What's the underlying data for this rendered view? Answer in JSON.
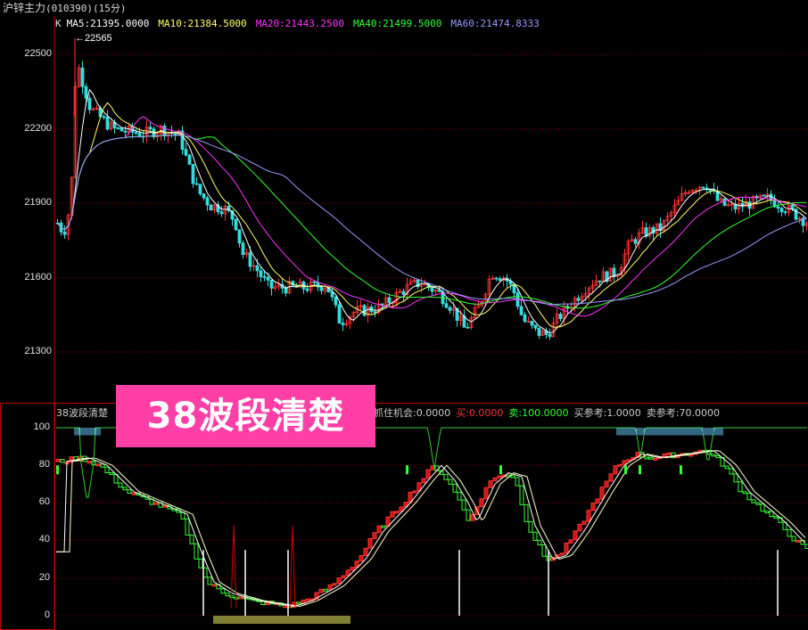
{
  "window": {
    "title": "沪锌主力",
    "subtitle": "(010390)(15分)"
  },
  "main_pane": {
    "k_label": "K",
    "ma_legend": [
      {
        "label": "MA5:21395.0000",
        "color": "#ffffff"
      },
      {
        "label": "MA10:21384.5000",
        "color": "#ffff66"
      },
      {
        "label": "MA20:21443.2500",
        "color": "#ff33ff"
      },
      {
        "label": "MA40:21499.5000",
        "color": "#33ff33"
      },
      {
        "label": "MA60:21474.8333",
        "color": "#9999ff"
      }
    ],
    "high_marker": "←22565",
    "y_ticks": [
      "22500",
      "22200",
      "21900",
      "21600",
      "21300"
    ]
  },
  "indicator_pane": {
    "name": "38波段清楚",
    "values": [
      {
        "label": "抓住机会:0.0000",
        "color": "#cccccc"
      },
      {
        "label": "买:0.0000",
        "color": "#ff3333"
      },
      {
        "label": "卖:100.0000",
        "color": "#33ff33"
      },
      {
        "label": "买参考:1.0000",
        "color": "#cccccc"
      },
      {
        "label": "卖参考:70.0000",
        "color": "#cccccc"
      }
    ],
    "y_ticks": [
      "100",
      "80",
      "60",
      "40",
      "20",
      "0"
    ]
  },
  "overlay": {
    "text": "38波段清楚",
    "bg_color": "#ff3fa6"
  },
  "colors": {
    "up": "#ff3333",
    "down": "#33dddd",
    "grid": "#800000"
  }
}
